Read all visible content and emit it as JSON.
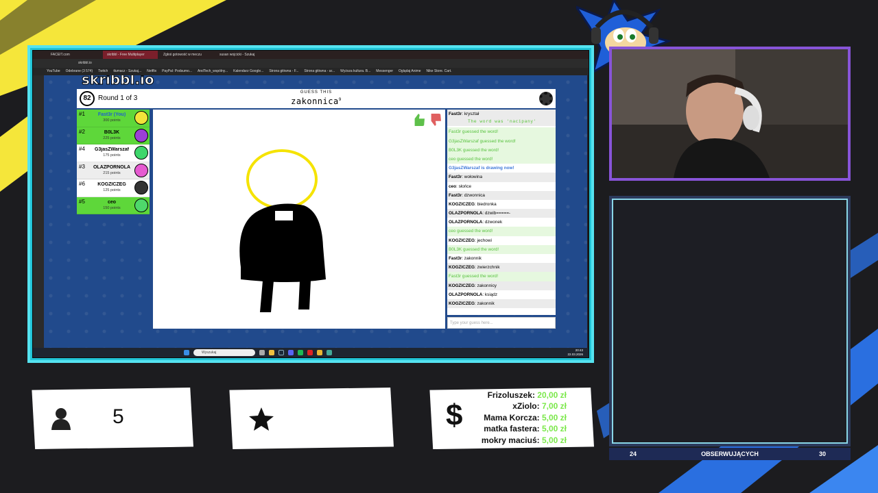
{
  "browser": {
    "tabs": [
      {
        "label": "FACEIT.com",
        "active": false
      },
      {
        "label": "skribbl - Free Multiplayer",
        "active": true
      },
      {
        "label": "Zgłoś gotowość w meczu",
        "active": false
      },
      {
        "label": "susan wojcicki - Szukaj",
        "active": false
      }
    ],
    "url": "skribbl.io",
    "bookmarks": [
      "YouTube",
      "Odebrane (3 574)",
      "Twitch",
      "tłumacz - Szukaj...",
      "Netflix",
      "PayPal: Podsumo...",
      "AndTech_wspólny...",
      "Kalendarz Google...",
      "Strona główna - F...",
      "Strona główna - ar...",
      "Wyższa kultura. B...",
      "Messenger",
      "Oglądaj Anime",
      "Nike Store. Cart."
    ]
  },
  "game": {
    "logo": "skribbl.io",
    "timer": "82",
    "round": "Round 1 of 3",
    "guess_label": "GUESS THIS",
    "word": "zakonnica",
    "word_len": "9",
    "players": [
      {
        "rank": "#1",
        "name": "Fast3r (You)",
        "points": "300 points",
        "bg": "#5ed73a",
        "avatar": "#f2e33a",
        "self": true
      },
      {
        "rank": "#2",
        "name": "B0L3K",
        "points": "225 points",
        "bg": "#5ed73a",
        "avatar": "#9b3fd6",
        "self": false
      },
      {
        "rank": "#4",
        "name": "G3jasZWarszaf",
        "points": "175 points",
        "bg": "#ffffff",
        "avatar": "#3ed66b",
        "self": false
      },
      {
        "rank": "#3",
        "name": "OLAZPORNOLA",
        "points": "215 points",
        "bg": "#ededed",
        "avatar": "#e65bd1",
        "self": false
      },
      {
        "rank": "#6",
        "name": "KOGZICZEG",
        "points": "125 points",
        "bg": "#ffffff",
        "avatar": "#333333",
        "self": false
      },
      {
        "rank": "#5",
        "name": "ceo",
        "points": "150 points",
        "bg": "#5ed73a",
        "avatar": "#4ed86b",
        "self": false
      }
    ],
    "chat": [
      {
        "user": "Fast3r",
        "text": "kryształ",
        "style": "alt"
      },
      {
        "user": "ceo",
        "text": "gang",
        "style": ""
      },
      {
        "user": "",
        "text": "Fast3r guessed the word!",
        "style": "ok"
      },
      {
        "user": "",
        "text": "G3jasZWarszaf guessed the word!",
        "style": "ok"
      },
      {
        "user": "",
        "text": "B0L3K guessed the word!",
        "style": "ok"
      },
      {
        "user": "",
        "text": "ceo guessed the word!",
        "style": "ok"
      },
      {
        "user": "",
        "text": "The word was 'nacipany'",
        "style": "word alt"
      },
      {
        "user": "",
        "text": "G3jasZWarszaf is drawing now!",
        "style": "info"
      },
      {
        "user": "Fast3r",
        "text": "wołowina",
        "style": "alt"
      },
      {
        "user": "ceo",
        "text": "słońce",
        "style": ""
      },
      {
        "user": "Fast3r",
        "text": "dzwonnica",
        "style": "alt"
      },
      {
        "user": "KOGZICZEG",
        "text": "biedronka",
        "style": ""
      },
      {
        "user": "OLAZPORNOLA",
        "text": "dzwib=====-",
        "style": "alt"
      },
      {
        "user": "OLAZPORNOLA",
        "text": "dzwonek",
        "style": ""
      },
      {
        "user": "",
        "text": "ceo guessed the word!",
        "style": "ok"
      },
      {
        "user": "KOGZICZEG",
        "text": "jechowi",
        "style": ""
      },
      {
        "user": "",
        "text": "B0L3K guessed the word!",
        "style": "ok"
      },
      {
        "user": "Fast3r",
        "text": "zakonnik",
        "style": ""
      },
      {
        "user": "KOGZICZEG",
        "text": "zwierzchnik",
        "style": "alt"
      },
      {
        "user": "",
        "text": "Fast3r guessed the word!",
        "style": "ok"
      },
      {
        "user": "KOGZICZEG",
        "text": "zakonnicy",
        "style": "alt"
      },
      {
        "user": "OLAZPORNOLA",
        "text": "ksiądz",
        "style": ""
      },
      {
        "user": "KOGZICZEG",
        "text": "zakonnik",
        "style": "alt"
      }
    ],
    "chat_placeholder": "Type your guess here..."
  },
  "taskbar": {
    "search": "Wyszukaj",
    "time": "20:43",
    "date": "22.03.2026"
  },
  "overlay": {
    "viewers": "5",
    "donations": [
      {
        "name": "Frizoluszek:",
        "amount": "20,00 zł"
      },
      {
        "name": "xZiolo:",
        "amount": "7,00 zł"
      },
      {
        "name": "Mama Korcza:",
        "amount": "5,00 zł"
      },
      {
        "name": "matka fastera:",
        "amount": "5,00 zł"
      },
      {
        "name": "mokry maciuś:",
        "amount": "5,00 zł"
      }
    ],
    "followers_label": "OBSERWUJĄCYCH",
    "followers_current": "24",
    "followers_goal": "30"
  },
  "colors": {
    "accent_cyan": "#55e3f0",
    "accent_purple": "#8854d8",
    "money_green": "#7be84a",
    "yellow": "#f5e63a"
  }
}
